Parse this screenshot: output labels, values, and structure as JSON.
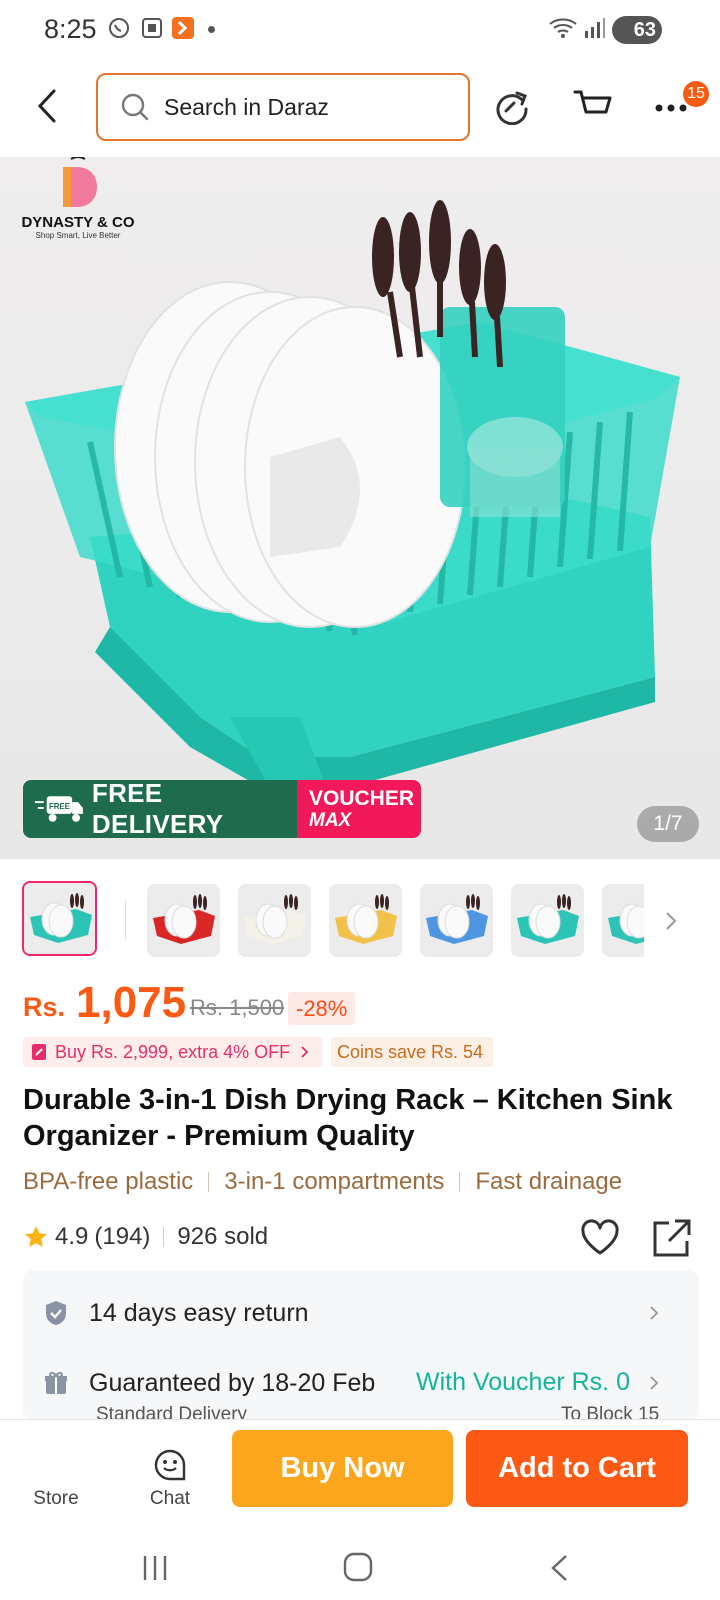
{
  "status_bar": {
    "time": "8:25",
    "battery": "63"
  },
  "header": {
    "search_placeholder": "Search in Daraz",
    "cart_badge": "15"
  },
  "hero": {
    "brand_name": "DYNASTY & CO",
    "brand_tagline": "Shop Smart, Live Better",
    "promo_free_badge": "FREE",
    "promo_free_delivery": "FREE DELIVERY",
    "promo_voucher": "VOUCHER",
    "promo_max": "MAX",
    "image_counter": "1/7"
  },
  "thumbnails": [
    {
      "color": "#2cc4b6",
      "selected": true
    },
    {
      "color": "#d92727"
    },
    {
      "color": "#f4f1e8"
    },
    {
      "color": "#f2c14a"
    },
    {
      "color": "#4f96e0"
    },
    {
      "color": "#2cc4b6"
    },
    {
      "color": "#2cc4b6"
    }
  ],
  "price": {
    "currency": "Rs.",
    "current": "1,075",
    "original": "Rs. 1,500",
    "discount": "-28%"
  },
  "offers": {
    "bundle": "Buy Rs. 2,999, extra 4% OFF",
    "coins": "Coins save Rs. 54"
  },
  "product": {
    "title": "Durable 3-in-1 Dish Drying Rack – Kitchen Sink Organizer - Premium Quality",
    "features": [
      "BPA-free plastic",
      "3-in-1 compartments",
      "Fast drainage"
    ],
    "rating": "4.9",
    "reviews": "(194)",
    "sold": "926 sold"
  },
  "services": {
    "return_label": "14 days easy return",
    "delivery_label": "Guaranteed by 18-20 Feb",
    "delivery_voucher": "With Voucher Rs. 0",
    "delivery_sub": "Standard Delivery",
    "delivery_to": "To Block 15"
  },
  "bottom_bar": {
    "store_label": "Store",
    "chat_label": "Chat",
    "buy_now": "Buy Now",
    "add_to_cart": "Add to Cart"
  },
  "colors": {
    "accent": "#fc5a14",
    "buy_now": "#fba61d",
    "add_to_cart": "#fc5a14",
    "teal": "#14b3a0",
    "feature_text": "#9b6b3f"
  },
  "icons": [
    "back-icon",
    "search-icon",
    "share-icon",
    "cart-icon",
    "more-icon",
    "star-icon",
    "heart-icon",
    "external-share-icon",
    "shield-icon",
    "gift-icon",
    "chevron-right-icon",
    "chat-icon"
  ]
}
